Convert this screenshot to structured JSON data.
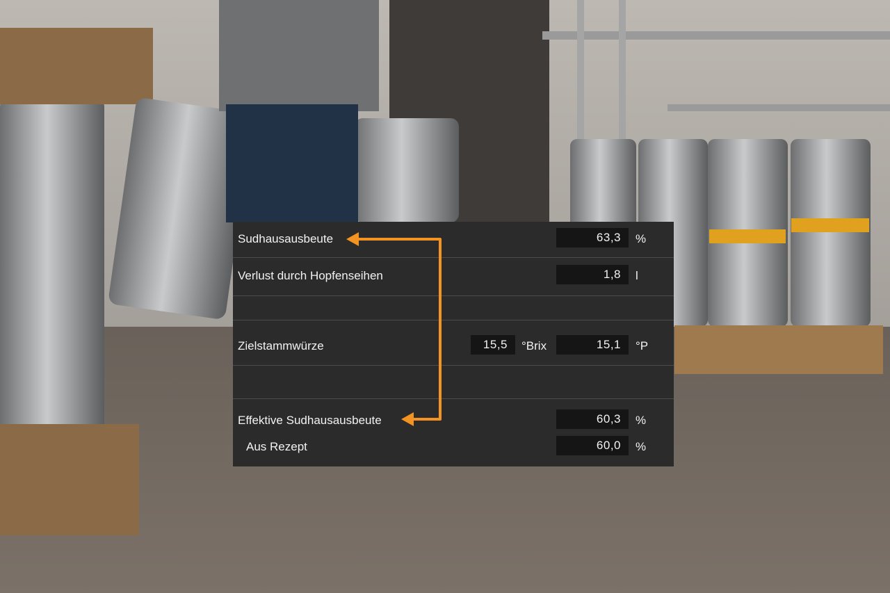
{
  "panel": {
    "rows": {
      "brewhouse_yield": {
        "label": "Sudhausausbeute",
        "value": "63,3",
        "unit": "%"
      },
      "hop_loss": {
        "label": "Verlust durch Hopfenseihen",
        "value": "1,8",
        "unit": "l"
      },
      "target_gravity": {
        "label": "Zielstammwürze",
        "brix_value": "15,5",
        "brix_unit": "°Brix",
        "plato_value": "15,1",
        "plato_unit": "°P"
      },
      "effective_yield": {
        "label": "Effektive Sudhausausbeute",
        "value": "60,3",
        "unit": "%"
      },
      "from_recipe": {
        "label": "Aus Rezept",
        "value": "60,0",
        "unit": "%"
      }
    }
  },
  "colors": {
    "panel_bg": "#2b2b2b",
    "field_bg": "#151515",
    "accent_arrow": "#f39322",
    "text": "#f2f2f2"
  },
  "icons": {
    "connector": "orange-bracket-arrow-icon"
  }
}
